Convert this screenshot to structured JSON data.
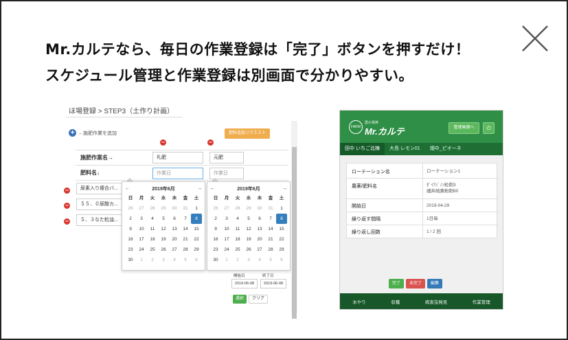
{
  "headline": {
    "line1": "Mr.カルテなら、毎日の作業登録は「完了」ボタンを押すだけ！",
    "line2": "スケジュール管理と作業登録は別画面で分かりやすい。"
  },
  "left_screen": {
    "breadcrumb": "ほ場登録 > STEP3（土作り計画）",
    "add_label": "←施肥作業を追加",
    "request_button": "肥料追加リクエスト",
    "col1_header": "施肥作業名→",
    "col2_header": "肥料名↓",
    "col1_value": "礼肥",
    "col2_value": "元肥",
    "date_placeholder_1": "作業日",
    "date_placeholder_2": "作業日",
    "row_inputs": [
      "尿素入り複合バ...",
      "５５．０尿酸カ...",
      "５．３なた粒油..."
    ],
    "calendar": {
      "month": "2019年6月",
      "prev": "←",
      "next": "→",
      "dow": [
        "日",
        "月",
        "火",
        "水",
        "木",
        "金",
        "土"
      ],
      "days": [
        [
          "26",
          "27",
          "28",
          "29",
          "30",
          "31",
          "1"
        ],
        [
          "2",
          "3",
          "4",
          "5",
          "6",
          "7",
          "8"
        ],
        [
          "9",
          "10",
          "11",
          "12",
          "13",
          "14",
          "15"
        ],
        [
          "16",
          "17",
          "18",
          "19",
          "20",
          "21",
          "22"
        ],
        [
          "23",
          "24",
          "25",
          "26",
          "27",
          "28",
          "29"
        ],
        [
          "30",
          "1",
          "2",
          "3",
          "4",
          "5",
          "6"
        ]
      ],
      "selected": "8"
    },
    "start_label": "開始日",
    "end_label": "終了日",
    "start_date": "2019-06-08",
    "end_date": "2019-06-08",
    "select_button": "選択",
    "clear_button": "クリア"
  },
  "right_screen": {
    "logo_small": "農の相棒",
    "logo_main": "Mr.カルテ",
    "logo_badge": "FARM",
    "manage_button": "管理画面へ",
    "power_icon": "power-icon",
    "tabs": [
      "田中 いちご北棟",
      "大島 レモン01",
      "畑中_ピオーネ"
    ],
    "rows": [
      {
        "key": "ローテーション名",
        "value": "ローテーション1"
      },
      {
        "key": "農薬/肥料名",
        "value": "ﾀﾞｲｱｼﾞﾉﾝ粒剤3\n細井硫黄粉剤80"
      },
      {
        "key": "開始日",
        "value": "2019-04-29"
      },
      {
        "key": "繰り返す間隔",
        "value": "1日毎"
      },
      {
        "key": "繰り返し回数",
        "value": "1 / 2 回"
      }
    ],
    "buttons": [
      {
        "label": "完了",
        "color": "#4cae4c"
      },
      {
        "label": "未完了",
        "color": "#d9534f"
      },
      {
        "label": "編集",
        "color": "#337ab7"
      }
    ],
    "footer": [
      "水やり",
      "収穫",
      "病害虫発見",
      "作業管理"
    ]
  }
}
